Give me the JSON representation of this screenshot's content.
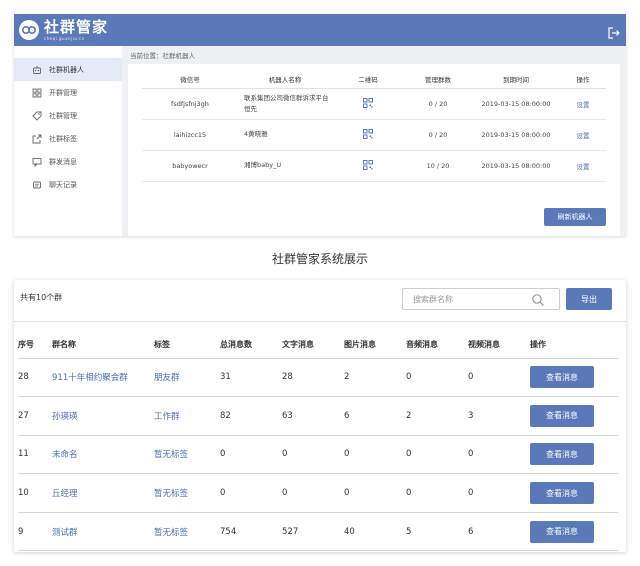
{
  "top": {
    "logo": {
      "title": "社群管家",
      "subtitle": "sheqi.guanjia.cn"
    },
    "breadcrumb": "当前位置：社群机器人",
    "sidebar": [
      {
        "label": "社群机器人",
        "icon": "robot-icon",
        "active": true
      },
      {
        "label": "开群管理",
        "icon": "grid-icon",
        "active": false
      },
      {
        "label": "社群管理",
        "icon": "tag-icon",
        "active": false
      },
      {
        "label": "社群标签",
        "icon": "export-icon",
        "active": false
      },
      {
        "label": "群发消息",
        "icon": "message-icon",
        "active": false
      },
      {
        "label": "聊天记录",
        "icon": "chat-record-icon",
        "active": false
      }
    ],
    "table": {
      "headers": [
        "微信号",
        "机器人名称",
        "二维码",
        "管理群数",
        "到期时间",
        "操作"
      ],
      "rows": [
        {
          "wechat": "fsdfjsfnj3gh",
          "name": "联系集团公司微信群诉求平台恒先",
          "groups": "0 / 20",
          "expire": "2019-03-15 08:00:00",
          "action": "设置"
        },
        {
          "wechat": "laihizcc15",
          "name": "4黄晓雅",
          "groups": "0 / 20",
          "expire": "2019-03-15 08:00:00",
          "action": "设置"
        },
        {
          "wechat": "babyowecr",
          "name": "湘博baby_U",
          "groups": "10 / 20",
          "expire": "2019-03-15 08:00:00",
          "action": "设置"
        }
      ]
    },
    "refresh_label": "刷新机器人"
  },
  "caption": "社群管家系统展示",
  "bottom": {
    "count_text": "共有10个群",
    "search_placeholder": "搜索群名称",
    "export_label": "导出",
    "headers": [
      "序号",
      "群名称",
      "标签",
      "总消息数",
      "文字消息",
      "图片消息",
      "音频消息",
      "视频消息",
      "操作"
    ],
    "rows": [
      {
        "id": "28",
        "name": "911十年相约聚会群",
        "tag": "朋友群",
        "total": "31",
        "text": "28",
        "image": "2",
        "audio": "0",
        "video": "0",
        "action": "查看消息"
      },
      {
        "id": "27",
        "name": "孙瑛瑛",
        "tag": "工作群",
        "total": "82",
        "text": "63",
        "image": "6",
        "audio": "2",
        "video": "3",
        "action": "查看消息"
      },
      {
        "id": "11",
        "name": "未命名",
        "tag": "暂无标签",
        "total": "0",
        "text": "0",
        "image": "0",
        "audio": "0",
        "video": "0",
        "action": "查看消息"
      },
      {
        "id": "10",
        "name": "丘经理",
        "tag": "暂无标签",
        "total": "0",
        "text": "0",
        "image": "0",
        "audio": "0",
        "video": "0",
        "action": "查看消息"
      },
      {
        "id": "9",
        "name": "测试群",
        "tag": "暂无标签",
        "total": "754",
        "text": "527",
        "image": "40",
        "audio": "5",
        "video": "6",
        "action": "查看消息"
      }
    ]
  },
  "colors": {
    "brand": "#5b79b8",
    "link": "#4a6fb5",
    "active_bg": "#e4ebf7"
  }
}
